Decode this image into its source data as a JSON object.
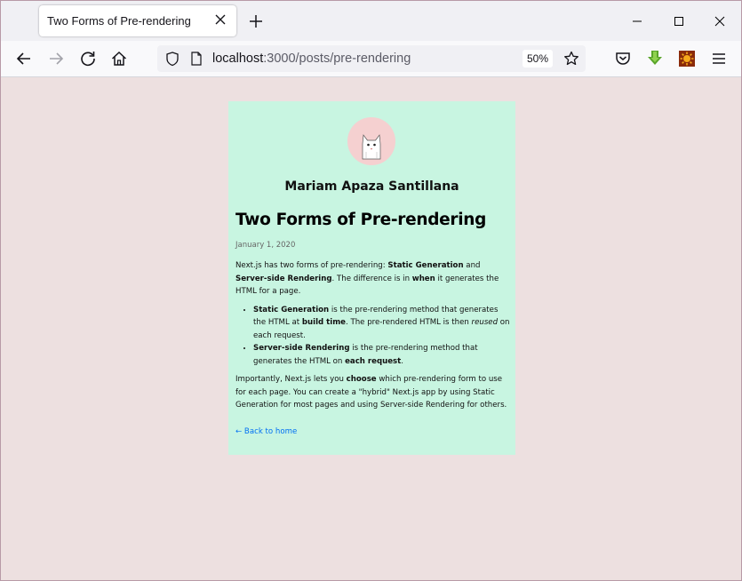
{
  "browser": {
    "tab_title": "Two Forms of Pre-rendering",
    "url_host": "localhost",
    "url_path": ":3000/posts/pre-rendering",
    "zoom": "50%"
  },
  "post": {
    "author": "Mariam Apaza Santillana",
    "title": "Two Forms of Pre-rendering",
    "date": "January 1, 2020",
    "intro": {
      "t1": "Next.js has two forms of pre-rendering: ",
      "b1": "Static Generation",
      "t2": " and ",
      "b2": "Server-side Rendering",
      "t3": ". The difference is in ",
      "b3": "when",
      "t4": " it generates the HTML for a page."
    },
    "item1": {
      "b1": "Static Generation",
      "t1": " is the pre-rendering method that generates the HTML at ",
      "b2": "build time",
      "t2": ". The pre-rendered HTML is then ",
      "i1": "reused",
      "t3": " on each request."
    },
    "item2": {
      "b1": "Server-side Rendering",
      "t1": " is the pre-rendering method that generates the HTML on ",
      "b2": "each request",
      "t2": "."
    },
    "outro": {
      "t1": "Importantly, Next.js lets you ",
      "b1": "choose",
      "t2": " which pre-rendering form to use for each page. You can create a \"hybrid\" Next.js app by using Static Generation for most pages and using Server-side Rendering for others."
    },
    "back_link": "← Back to home"
  },
  "colors": {
    "card_bg": "#c8f5e1",
    "page_bg": "#ede0e0",
    "link": "#0070f3"
  }
}
